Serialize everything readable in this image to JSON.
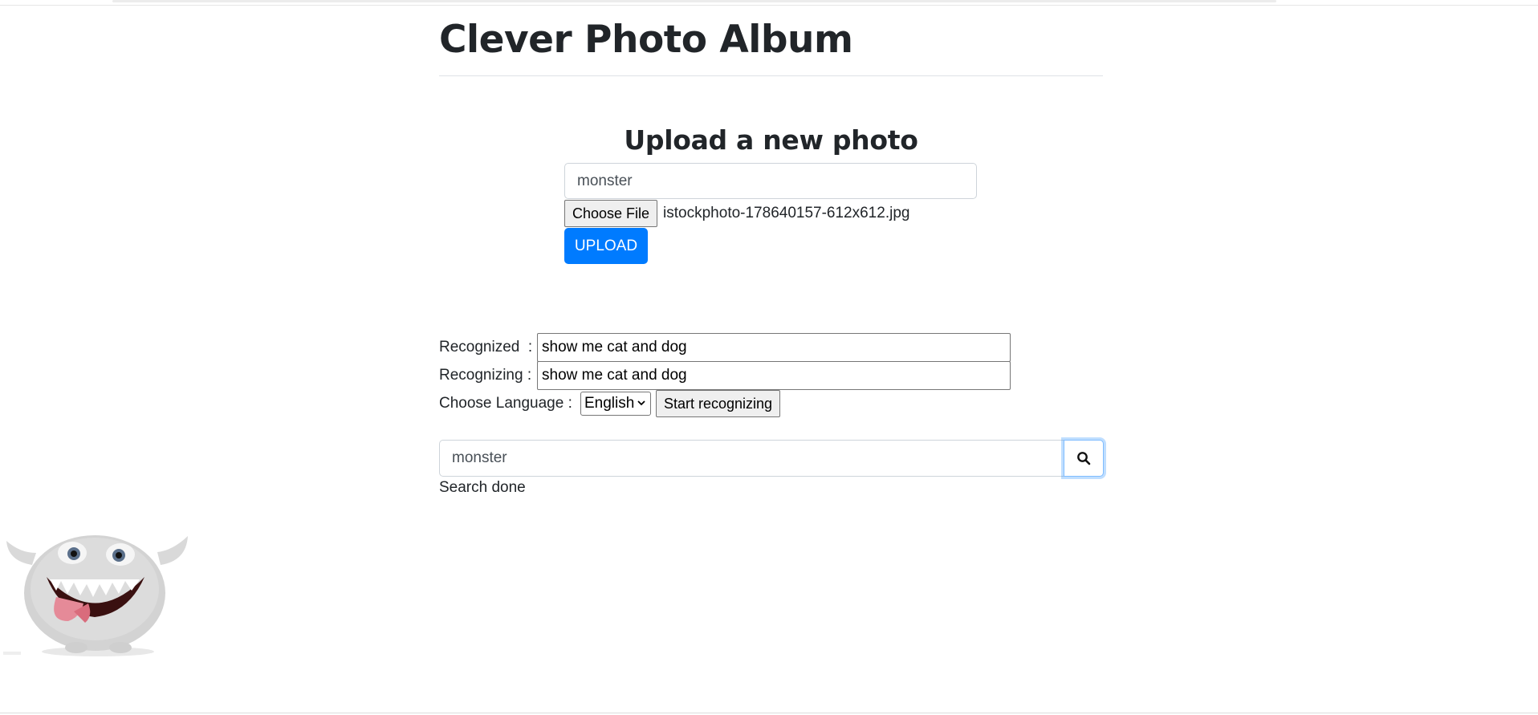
{
  "page": {
    "title": "Clever Photo Album"
  },
  "upload": {
    "heading": "Upload a new photo",
    "caption_value": "monster",
    "choose_file_label": "Choose File",
    "file_name": "istockphoto-178640157-612x612.jpg",
    "upload_label": "UPLOAD",
    "accent_color": "#007bff"
  },
  "speech": {
    "recognized_label": "Recognized  :",
    "recognized_value": "show me cat and dog",
    "recognizing_label": "Recognizing :",
    "recognizing_value": "show me cat and dog",
    "language_label": "Choose Language :",
    "language_selected": "English",
    "start_label": "Start recognizing"
  },
  "search": {
    "query_value": "monster",
    "button_icon": "search-icon",
    "status": "Search done"
  },
  "results": {
    "photos": [
      {
        "subject": "furry gray monster with tongue out"
      }
    ]
  }
}
